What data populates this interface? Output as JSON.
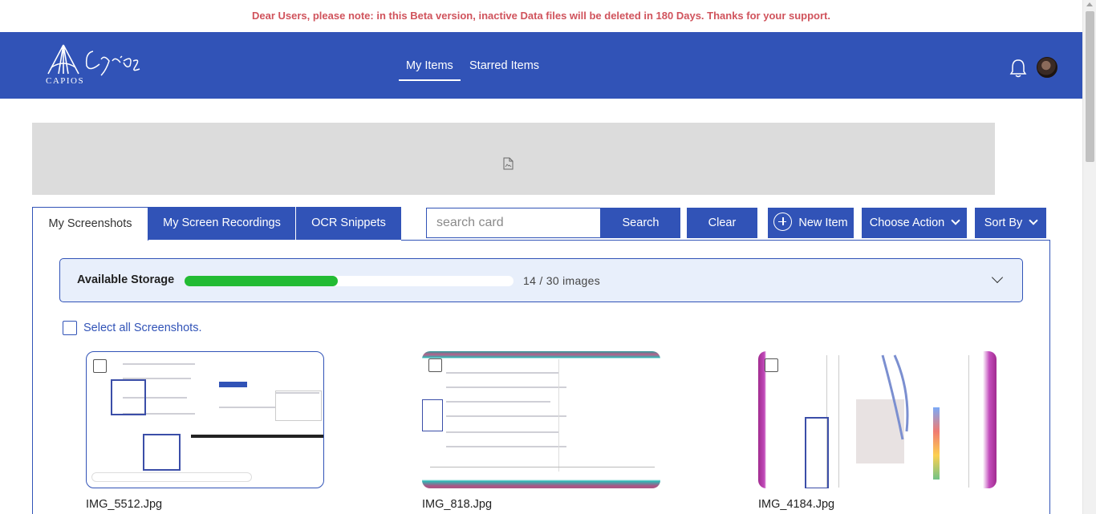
{
  "notice": "Dear Users, please note: in this Beta version, inactive Data files will be deleted in 180 Days. Thanks for your support.",
  "navbar": {
    "logo_text": "CAPIOS",
    "logo_script": "Capios",
    "tabs": [
      {
        "label": "My Items",
        "active": true
      },
      {
        "label": "Starred Items",
        "active": false
      }
    ],
    "icons": [
      "bell-icon",
      "avatar"
    ]
  },
  "tabs": [
    {
      "label": "My Screenshots",
      "active": true
    },
    {
      "label": "My Screen Recordings",
      "active": false
    },
    {
      "label": "OCR Snippets",
      "active": false
    }
  ],
  "toolbar": {
    "search_placeholder": "search card",
    "search_label": "Search",
    "clear_label": "Clear",
    "new_item_label": "New Item",
    "choose_action_label": "Choose Action",
    "sort_by_label": "Sort By"
  },
  "storage": {
    "label": "Available Storage",
    "used": 14,
    "total": 30,
    "count_text": "14 / 30 images"
  },
  "select_all_label": "Select all Screenshots.",
  "cards": [
    {
      "name": "IMG_5512.Jpg"
    },
    {
      "name": "IMG_818.Jpg"
    },
    {
      "name": "IMG_4184.Jpg"
    }
  ],
  "colors": {
    "brand": "#3153b7",
    "notice": "#d0535c",
    "progress": "#22bb33",
    "storage_bg": "#e8effb"
  }
}
